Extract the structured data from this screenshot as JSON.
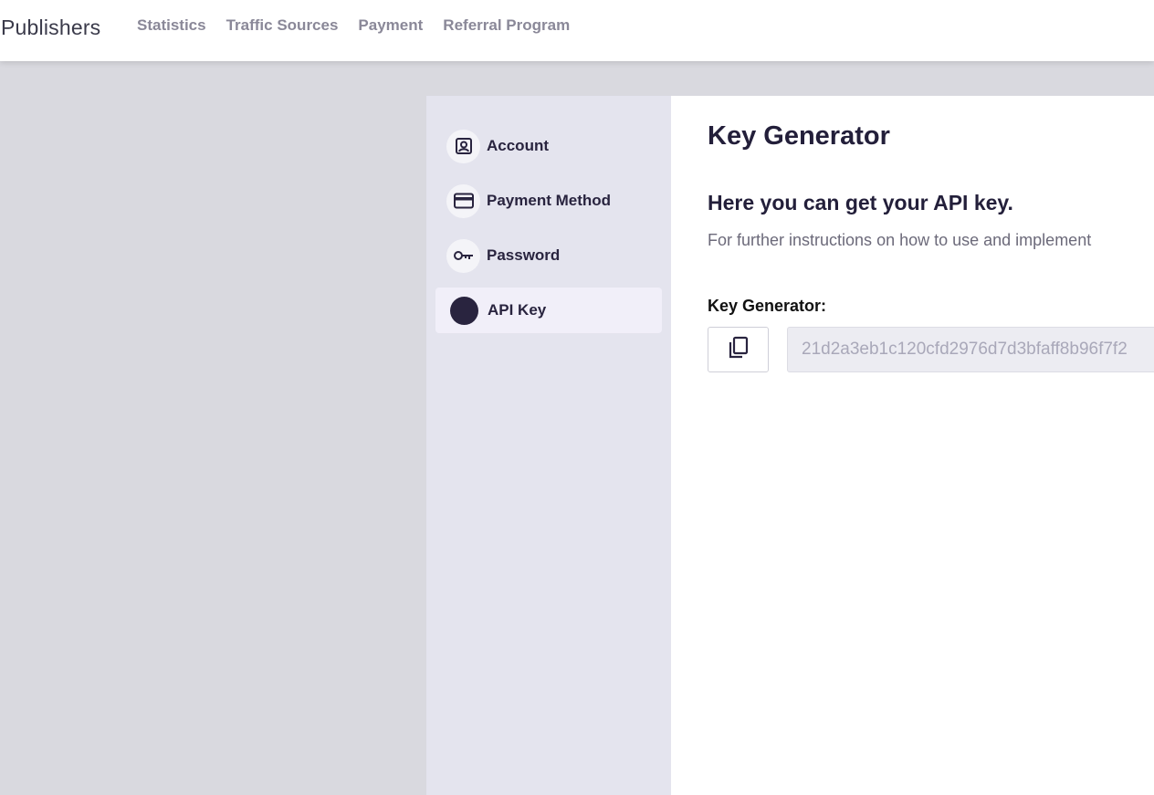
{
  "header": {
    "brand": "Publishers",
    "nav": [
      "Statistics",
      "Traffic Sources",
      "Payment",
      "Referral Program"
    ]
  },
  "sidebar": {
    "items": [
      {
        "label": "Account",
        "icon": "account-box-icon"
      },
      {
        "label": "Payment Method",
        "icon": "credit-card-icon"
      },
      {
        "label": "Password",
        "icon": "key-icon"
      },
      {
        "label": "API Key",
        "icon": "api-key-dot-icon",
        "active": true
      }
    ]
  },
  "main": {
    "title": "Key Generator",
    "subtitle": "Here you can get your API key.",
    "instructions": "For further instructions on how to use and implement",
    "key_label": "Key Generator:",
    "api_key_value": "21d2a3eb1c120cfd2976d7d3bfaff8b96f7f2",
    "copy_icon": "copy-icon"
  },
  "colors": {
    "background": "#d9d9df",
    "sidebar": "#e4e4ee",
    "active_item": "#f1eff9",
    "text_dark": "#26223f",
    "nav_text": "#8a8898"
  }
}
